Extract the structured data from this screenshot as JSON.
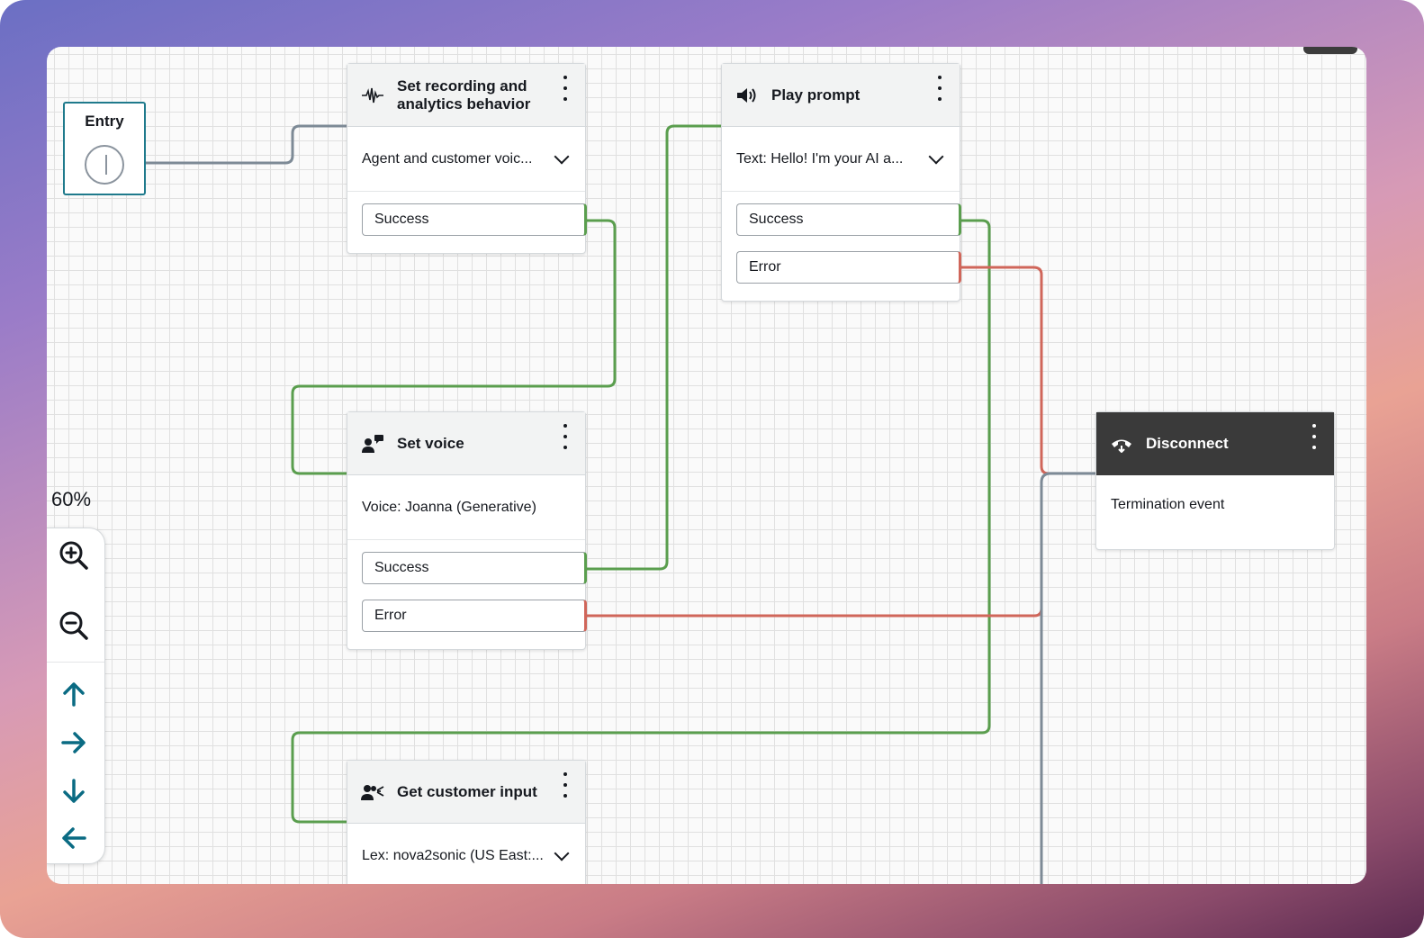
{
  "zoom": {
    "level": "60%"
  },
  "entry": {
    "title": "Entry"
  },
  "blocks": {
    "recording": {
      "title_line1": "Set recording and",
      "title_line2": "analytics behavior",
      "config": "Agent and customer voic...",
      "branches": [
        "Success"
      ]
    },
    "play_prompt": {
      "title": "Play prompt",
      "config": "Text: Hello! I'm your AI a...",
      "branches": [
        "Success",
        "Error"
      ]
    },
    "set_voice": {
      "title": "Set voice",
      "config": "Voice: Joanna (Generative)",
      "branches": [
        "Success",
        "Error"
      ]
    },
    "disconnect": {
      "title": "Disconnect",
      "config": "Termination event"
    },
    "get_input": {
      "title": "Get customer input",
      "config": "Lex: nova2sonic (US East:..."
    }
  },
  "colors": {
    "success_wire": "#5a9e4e",
    "error_wire": "#d0665a",
    "default_wire": "#7d8a96",
    "accent": "#1f7a8c"
  },
  "icons": {
    "recording": "waveform-icon",
    "play_prompt": "speaker-icon",
    "set_voice": "person-speech-icon",
    "disconnect": "hang-up-icon",
    "get_input": "person-input-icon"
  }
}
